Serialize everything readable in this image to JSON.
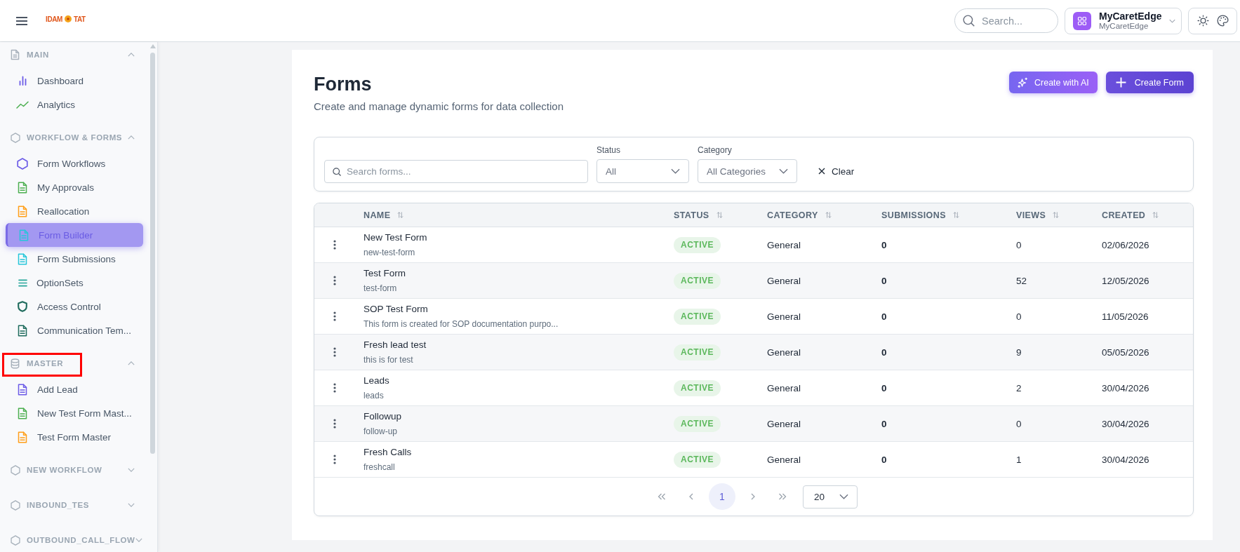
{
  "header": {
    "logo": {
      "left": "IDAM",
      "right": "TAT"
    },
    "search": {
      "placeholder": "Search..."
    },
    "organization": {
      "name": "MyCaretEdge",
      "subtitle": "MyCaretEdge"
    }
  },
  "sidebar": {
    "sections": [
      {
        "title": "MAIN",
        "kind": "doc",
        "expanded": true,
        "highlighted": false,
        "items": [
          {
            "label": "Dashboard",
            "kind": "bars",
            "color": "#6c5ce7",
            "selected": false
          },
          {
            "label": "Analytics",
            "kind": "trend",
            "color": "#4caf50",
            "selected": false
          }
        ]
      },
      {
        "title": "WORKFLOW & FORMS",
        "kind": "hexagon",
        "expanded": true,
        "highlighted": false,
        "items": [
          {
            "label": "Form Workflows",
            "kind": "hexagon",
            "color": "#6c5ce7",
            "selected": false
          },
          {
            "label": "My Approvals",
            "kind": "doc",
            "color": "#4caf50",
            "selected": false
          },
          {
            "label": "Reallocation",
            "kind": "doc",
            "color": "#ff9f1a",
            "selected": false
          },
          {
            "label": "Form Builder",
            "kind": "doc",
            "color": "#26c6da",
            "selected": true
          },
          {
            "label": "Form Submissions",
            "kind": "doc",
            "color": "#26c6da",
            "selected": false
          },
          {
            "label": "OptionSets",
            "kind": "list",
            "color": "#26a69a",
            "selected": false
          },
          {
            "label": "Access Control",
            "kind": "shield",
            "color": "#1e6b5c",
            "selected": false
          },
          {
            "label": "Communication Tem...",
            "kind": "doc",
            "color": "#1e6b5c",
            "selected": false
          }
        ]
      },
      {
        "title": "MASTER",
        "kind": "database",
        "expanded": true,
        "highlighted": true,
        "items": [
          {
            "label": "Add Lead",
            "kind": "doc",
            "color": "#6c5ce7",
            "selected": false
          },
          {
            "label": "New Test Form Mast...",
            "kind": "doc",
            "color": "#4caf50",
            "selected": false
          },
          {
            "label": "Test Form Master",
            "kind": "doc",
            "color": "#ff9f1a",
            "selected": false
          }
        ]
      },
      {
        "title": "NEW WORKFLOW",
        "kind": "hexagon",
        "expanded": false,
        "highlighted": false
      },
      {
        "title": "INBOUND_TES",
        "kind": "hexagon",
        "expanded": false,
        "highlighted": false
      },
      {
        "title": "OUTBOUND_CALL_FLOW",
        "kind": "hexagon",
        "expanded": false,
        "highlighted": false
      }
    ]
  },
  "page": {
    "title": "Forms",
    "subtitle": "Create and manage dynamic forms for data collection",
    "actions": [
      {
        "label": "Create with AI",
        "kind": "ai"
      },
      {
        "label": "Create Form",
        "kind": "create"
      }
    ]
  },
  "filters": {
    "search": {
      "placeholder": "Search forms..."
    },
    "status": {
      "label": "Status",
      "value": "All"
    },
    "category": {
      "label": "Category",
      "value": "All Categories"
    },
    "clear": "Clear"
  },
  "table": {
    "columns": [
      "NAME",
      "STATUS",
      "CATEGORY",
      "SUBMISSIONS",
      "VIEWS",
      "CREATED"
    ],
    "rows": [
      {
        "name": "New Test Form",
        "slug": "new-test-form",
        "status": "ACTIVE",
        "category": "General",
        "submissions": "0",
        "views": "0",
        "created": "02/06/2026"
      },
      {
        "name": "Test Form",
        "slug": "test-form",
        "status": "ACTIVE",
        "category": "General",
        "submissions": "0",
        "views": "52",
        "created": "12/05/2026"
      },
      {
        "name": "SOP Test Form",
        "slug": "This form is created for SOP documentation purpo...",
        "status": "ACTIVE",
        "category": "General",
        "submissions": "0",
        "views": "0",
        "created": "11/05/2026"
      },
      {
        "name": "Fresh lead test",
        "slug": "this is for test",
        "status": "ACTIVE",
        "category": "General",
        "submissions": "0",
        "views": "9",
        "created": "05/05/2026"
      },
      {
        "name": "Leads",
        "slug": "leads",
        "status": "ACTIVE",
        "category": "General",
        "submissions": "0",
        "views": "2",
        "created": "30/04/2026"
      },
      {
        "name": "Followup",
        "slug": "follow-up",
        "status": "ACTIVE",
        "category": "General",
        "submissions": "0",
        "views": "0",
        "created": "30/04/2026"
      },
      {
        "name": "Fresh Calls",
        "slug": "freshcall",
        "status": "ACTIVE",
        "category": "General",
        "submissions": "0",
        "views": "1",
        "created": "30/04/2026"
      }
    ]
  },
  "pagination": {
    "pages": [
      {
        "label": "1",
        "selected": true
      }
    ],
    "page_size": "20"
  }
}
